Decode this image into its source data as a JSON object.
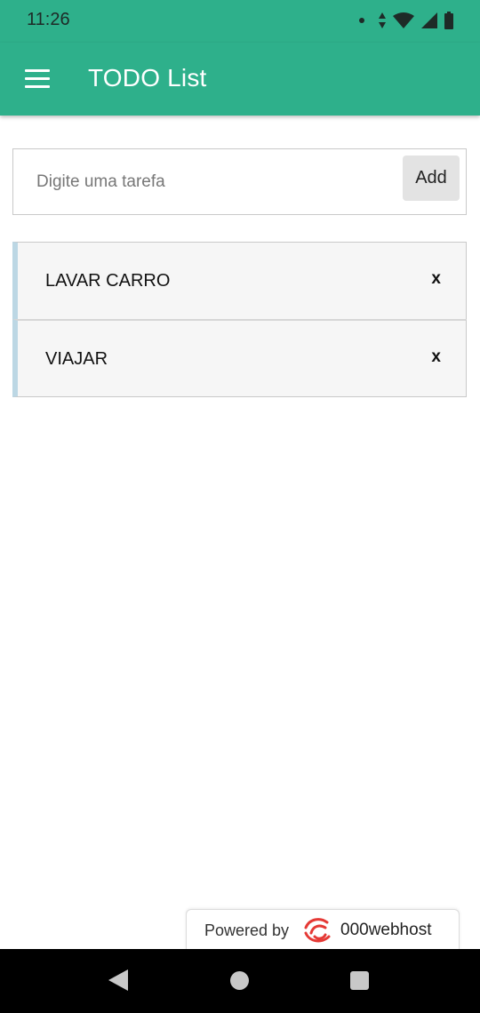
{
  "status_bar": {
    "time": "11:26",
    "icons": [
      "notification-dot-icon",
      "data-arrows-icon",
      "wifi-icon",
      "cell-signal-icon",
      "battery-icon"
    ]
  },
  "app_bar": {
    "title": "TODO List",
    "menu_icon": "hamburger-menu-icon",
    "color": "#2eb08b"
  },
  "task_input": {
    "value": "",
    "placeholder": "Digite uma tarefa",
    "add_label": "Add"
  },
  "tasks": [
    {
      "label": "LAVAR CARRO",
      "delete_label": "x"
    },
    {
      "label": "VIAJAR",
      "delete_label": "x"
    }
  ],
  "footer_badge": {
    "powered_by": "Powered by",
    "host": "000webhost",
    "logo_color": "#e53935"
  },
  "nav_bar": {
    "icons": [
      "back-icon",
      "home-icon",
      "recents-icon"
    ]
  }
}
